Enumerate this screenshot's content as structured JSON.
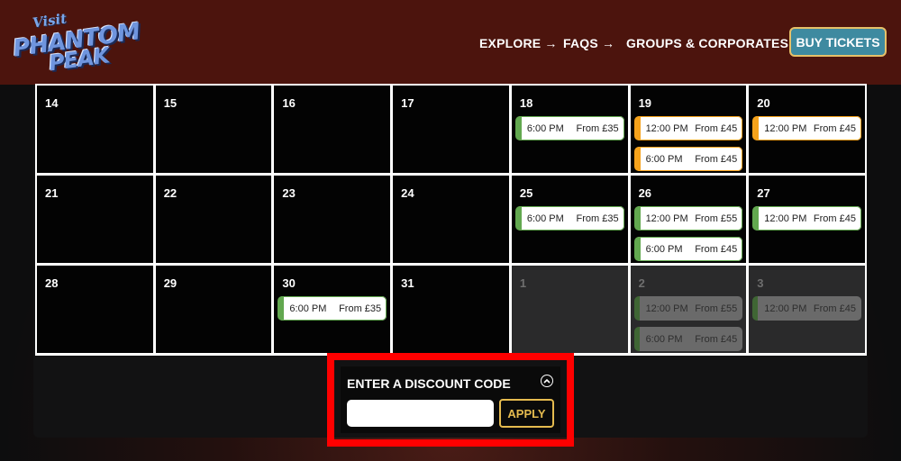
{
  "header": {
    "logo": {
      "visit": "Visit",
      "line1": "PHANTOM",
      "line2": "PEAK"
    },
    "nav": {
      "explore": "EXPLORE →",
      "faqs": "FAQS →",
      "groups": "GROUPS & CORPORATES →"
    },
    "buy_tickets": "BUY TICKETS",
    "colors": {
      "header_bg": "#4c140d",
      "buy_bg": "#3e8aa0",
      "accent_gold": "#e6c069"
    }
  },
  "calendar": {
    "weeks": [
      [
        {
          "day": "14",
          "slots": []
        },
        {
          "day": "15",
          "slots": []
        },
        {
          "day": "16",
          "slots": []
        },
        {
          "day": "17",
          "slots": []
        },
        {
          "day": "18",
          "slots": [
            {
              "time": "6:00 PM",
              "price": "From £35",
              "color": "green"
            }
          ]
        },
        {
          "day": "19",
          "slots": [
            {
              "time": "12:00 PM",
              "price": "From £45",
              "color": "orange"
            },
            {
              "time": "6:00 PM",
              "price": "From £45",
              "color": "orange"
            }
          ]
        },
        {
          "day": "20",
          "slots": [
            {
              "time": "12:00 PM",
              "price": "From £45",
              "color": "orange"
            }
          ]
        }
      ],
      [
        {
          "day": "21",
          "slots": []
        },
        {
          "day": "22",
          "slots": []
        },
        {
          "day": "23",
          "slots": []
        },
        {
          "day": "24",
          "slots": []
        },
        {
          "day": "25",
          "slots": [
            {
              "time": "6:00 PM",
              "price": "From £35",
              "color": "green"
            }
          ]
        },
        {
          "day": "26",
          "slots": [
            {
              "time": "12:00 PM",
              "price": "From £55",
              "color": "green"
            },
            {
              "time": "6:00 PM",
              "price": "From £45",
              "color": "green"
            }
          ]
        },
        {
          "day": "27",
          "slots": [
            {
              "time": "12:00 PM",
              "price": "From £45",
              "color": "green"
            }
          ]
        }
      ],
      [
        {
          "day": "28",
          "slots": []
        },
        {
          "day": "29",
          "slots": []
        },
        {
          "day": "30",
          "slots": [
            {
              "time": "6:00 PM",
              "price": "From £35",
              "color": "green"
            }
          ]
        },
        {
          "day": "31",
          "slots": []
        },
        {
          "day": "1",
          "other_month": true,
          "slots": []
        },
        {
          "day": "2",
          "other_month": true,
          "slots": [
            {
              "time": "12:00 PM",
              "price": "From £55",
              "color": "green"
            },
            {
              "time": "6:00 PM",
              "price": "From £45",
              "color": "green"
            }
          ]
        },
        {
          "day": "3",
          "other_month": true,
          "slots": [
            {
              "time": "12:00 PM",
              "price": "From £45",
              "color": "green"
            }
          ]
        }
      ]
    ]
  },
  "discount": {
    "title": "ENTER A DISCOUNT CODE",
    "input_value": "",
    "apply_label": "APPLY",
    "highlight_color": "#ff0000"
  }
}
